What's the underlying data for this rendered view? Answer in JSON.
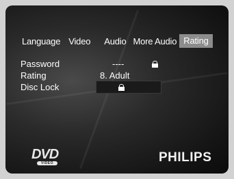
{
  "menu": {
    "tabs": [
      {
        "label": "Language",
        "selected": false
      },
      {
        "label": "Video",
        "selected": false
      },
      {
        "label": "Audio",
        "selected": false
      },
      {
        "label": "More Audio",
        "selected": false
      },
      {
        "label": "Rating",
        "selected": true
      }
    ]
  },
  "settings": {
    "password": {
      "label": "Password",
      "value": "----",
      "icon": "lock-icon"
    },
    "rating": {
      "label": "Rating",
      "value": "8.  Adult"
    },
    "disc_lock": {
      "label": "Disc Lock",
      "icon": "lock-icon"
    }
  },
  "branding": {
    "dvd_logo": "DVD",
    "dvd_logo_sub": "VIDEO",
    "brand": "PHILIPS"
  }
}
